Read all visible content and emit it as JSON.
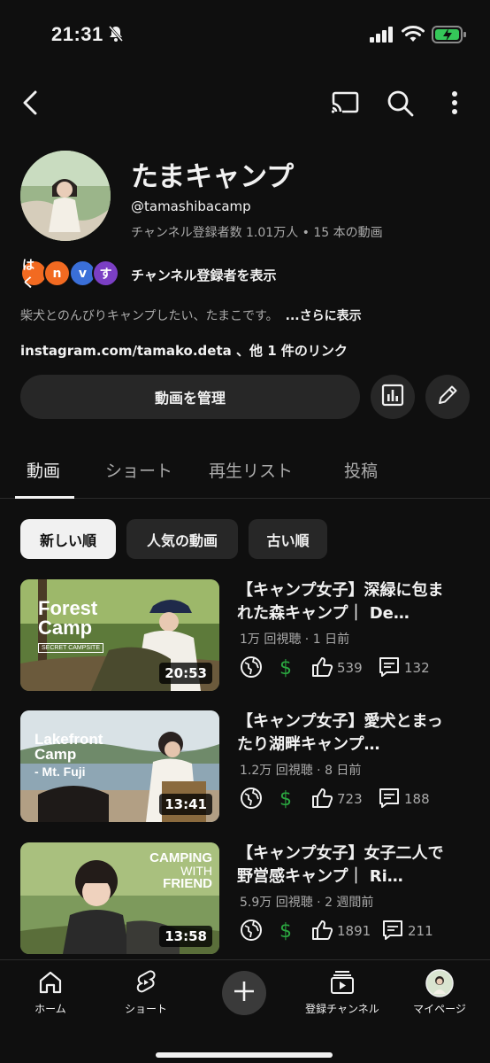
{
  "status_bar": {
    "time": "21:31",
    "icons": [
      "bell-slash-icon",
      "signal-icon",
      "wifi-icon",
      "battery-charging-icon"
    ]
  },
  "app_bar": {
    "icons": [
      "back-icon",
      "cast-icon",
      "search-icon",
      "more-vert-icon"
    ]
  },
  "channel": {
    "name": "たまキャンプ",
    "handle": "@tamashibacamp",
    "stats": "チャンネル登録者数 1.01万人 • 15 本の動画",
    "subscriber_chips": [
      {
        "text": "はく",
        "color": "#f26a21"
      },
      {
        "text": "n",
        "color": "#f26a21"
      },
      {
        "text": "v",
        "color": "#3a6fd8"
      },
      {
        "text": "す",
        "color": "#7b3fc4"
      }
    ],
    "subs_label": "チャンネル登録者を表示",
    "description": "柴犬とのんびりキャンプしたい、たまこです。",
    "description_more": "...さらに表示",
    "links": "instagram.com/tamako.deta 、他 1 件のリンク",
    "manage_label": "動画を管理"
  },
  "tabs": [
    "動画",
    "ショート",
    "再生リスト",
    "投稿"
  ],
  "filters": [
    "新しい順",
    "人気の動画",
    "古い順"
  ],
  "videos": [
    {
      "thumb_text": [
        "Forest",
        "Camp"
      ],
      "thumb_sub": "SECRET CAMPSITE",
      "duration": "20:53",
      "title": "【キャンプ女子】深緑に包まれた森キャンプ｜ De…",
      "meta": "1万 回視聴 · 1 日前",
      "likes": "539",
      "comments": "132"
    },
    {
      "thumb_text": [
        "Lakefront",
        "Camp"
      ],
      "thumb_sub": "- Mt. Fuji",
      "duration": "13:41",
      "title": "【キャンプ女子】愛犬とまったり湖畔キャンプ…",
      "meta": "1.2万 回視聴 · 8 日前",
      "likes": "723",
      "comments": "188"
    },
    {
      "thumb_text": [
        "CAMPING",
        "WITH",
        "FRIEND"
      ],
      "thumb_sub": "",
      "duration": "13:58",
      "title": "【キャンプ女子】女子二人で野営感キャンプ｜ Ri…",
      "meta": "5.9万 回視聴 · 2 週間前",
      "likes": "1891",
      "comments": "211"
    }
  ],
  "bottom_nav": [
    {
      "label": "ホーム",
      "icon": "home-icon"
    },
    {
      "label": "ショート",
      "icon": "shorts-icon"
    },
    {
      "label": "",
      "icon": "plus-icon"
    },
    {
      "label": "登録チャンネル",
      "icon": "subscriptions-icon"
    },
    {
      "label": "マイページ",
      "icon": "profile-avatar-icon"
    }
  ],
  "colors": {
    "background": "#0f0f0f",
    "surface": "#272727",
    "text": "#f1f1f1",
    "secondary": "#aaaaaa",
    "monetized": "#2ba640"
  }
}
